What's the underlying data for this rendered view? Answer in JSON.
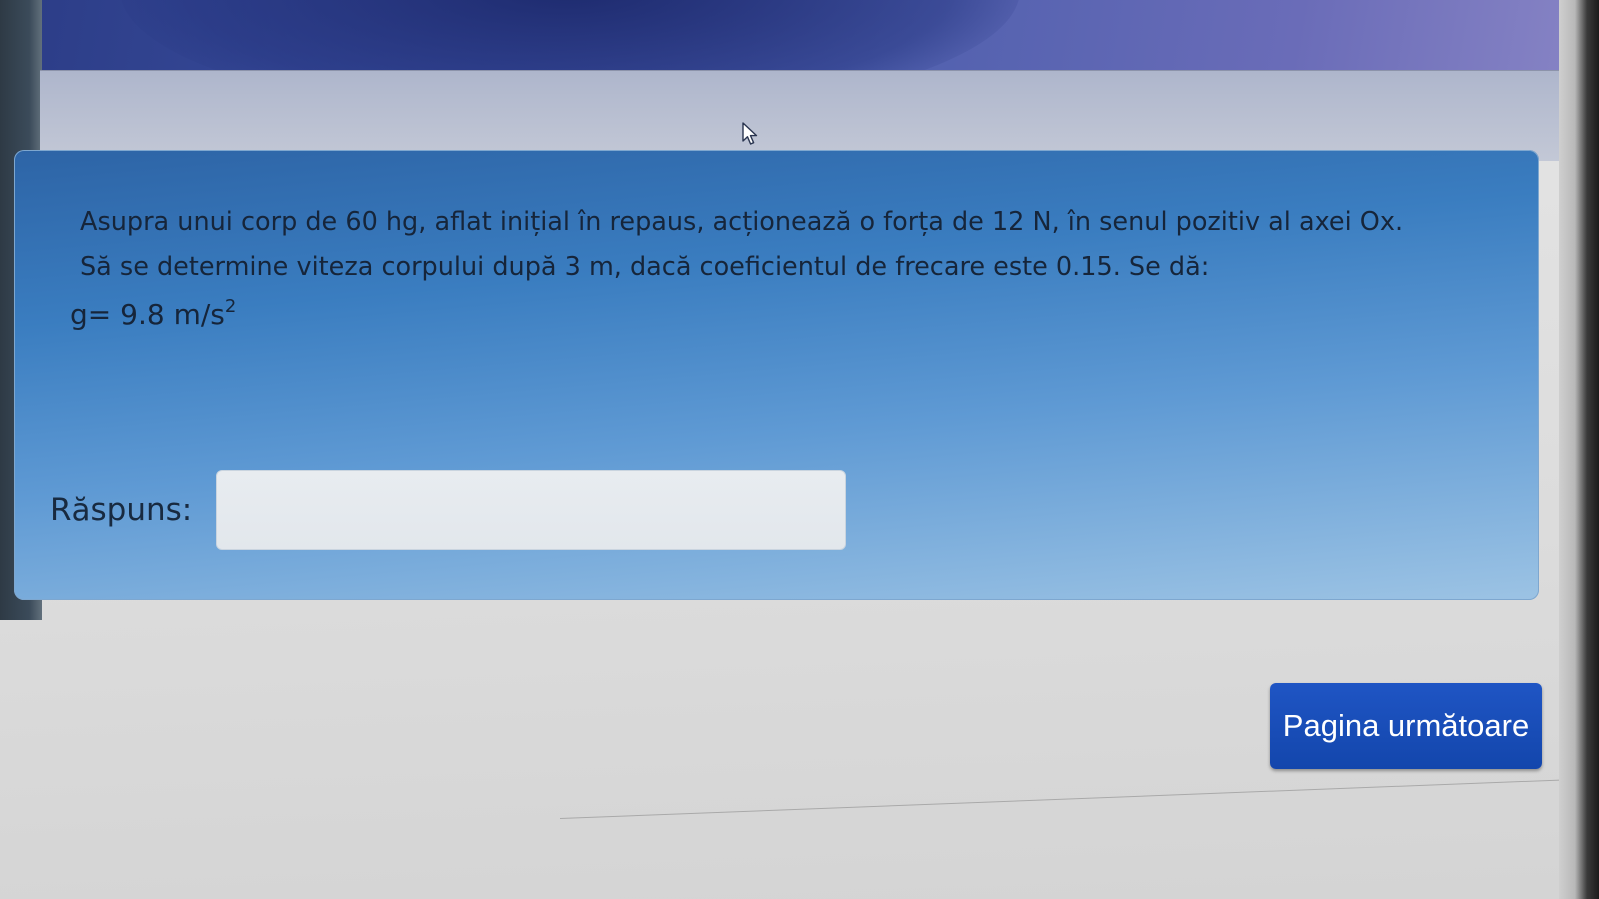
{
  "question": {
    "text": "Asupra unui corp de 60 hg, aflat inițial în repaus, acționează o forța de 12 N, în senul pozitiv al axei Ox. Să se determine viteza corpului după 3 m, dacă coeficientul de frecare este 0.15. Se dă:",
    "formula_main": "g= 9.8 m/s",
    "formula_exponent": "2"
  },
  "answer": {
    "label": "Răspuns:",
    "value": ""
  },
  "navigation": {
    "next_label": "Pagina următoare"
  },
  "icons": {
    "cursor": "mouse-pointer-icon"
  },
  "colors": {
    "question_background": "#3a7dc0",
    "button_background": "#1a4fba",
    "button_text": "#ffffff",
    "text": "#16253a"
  }
}
